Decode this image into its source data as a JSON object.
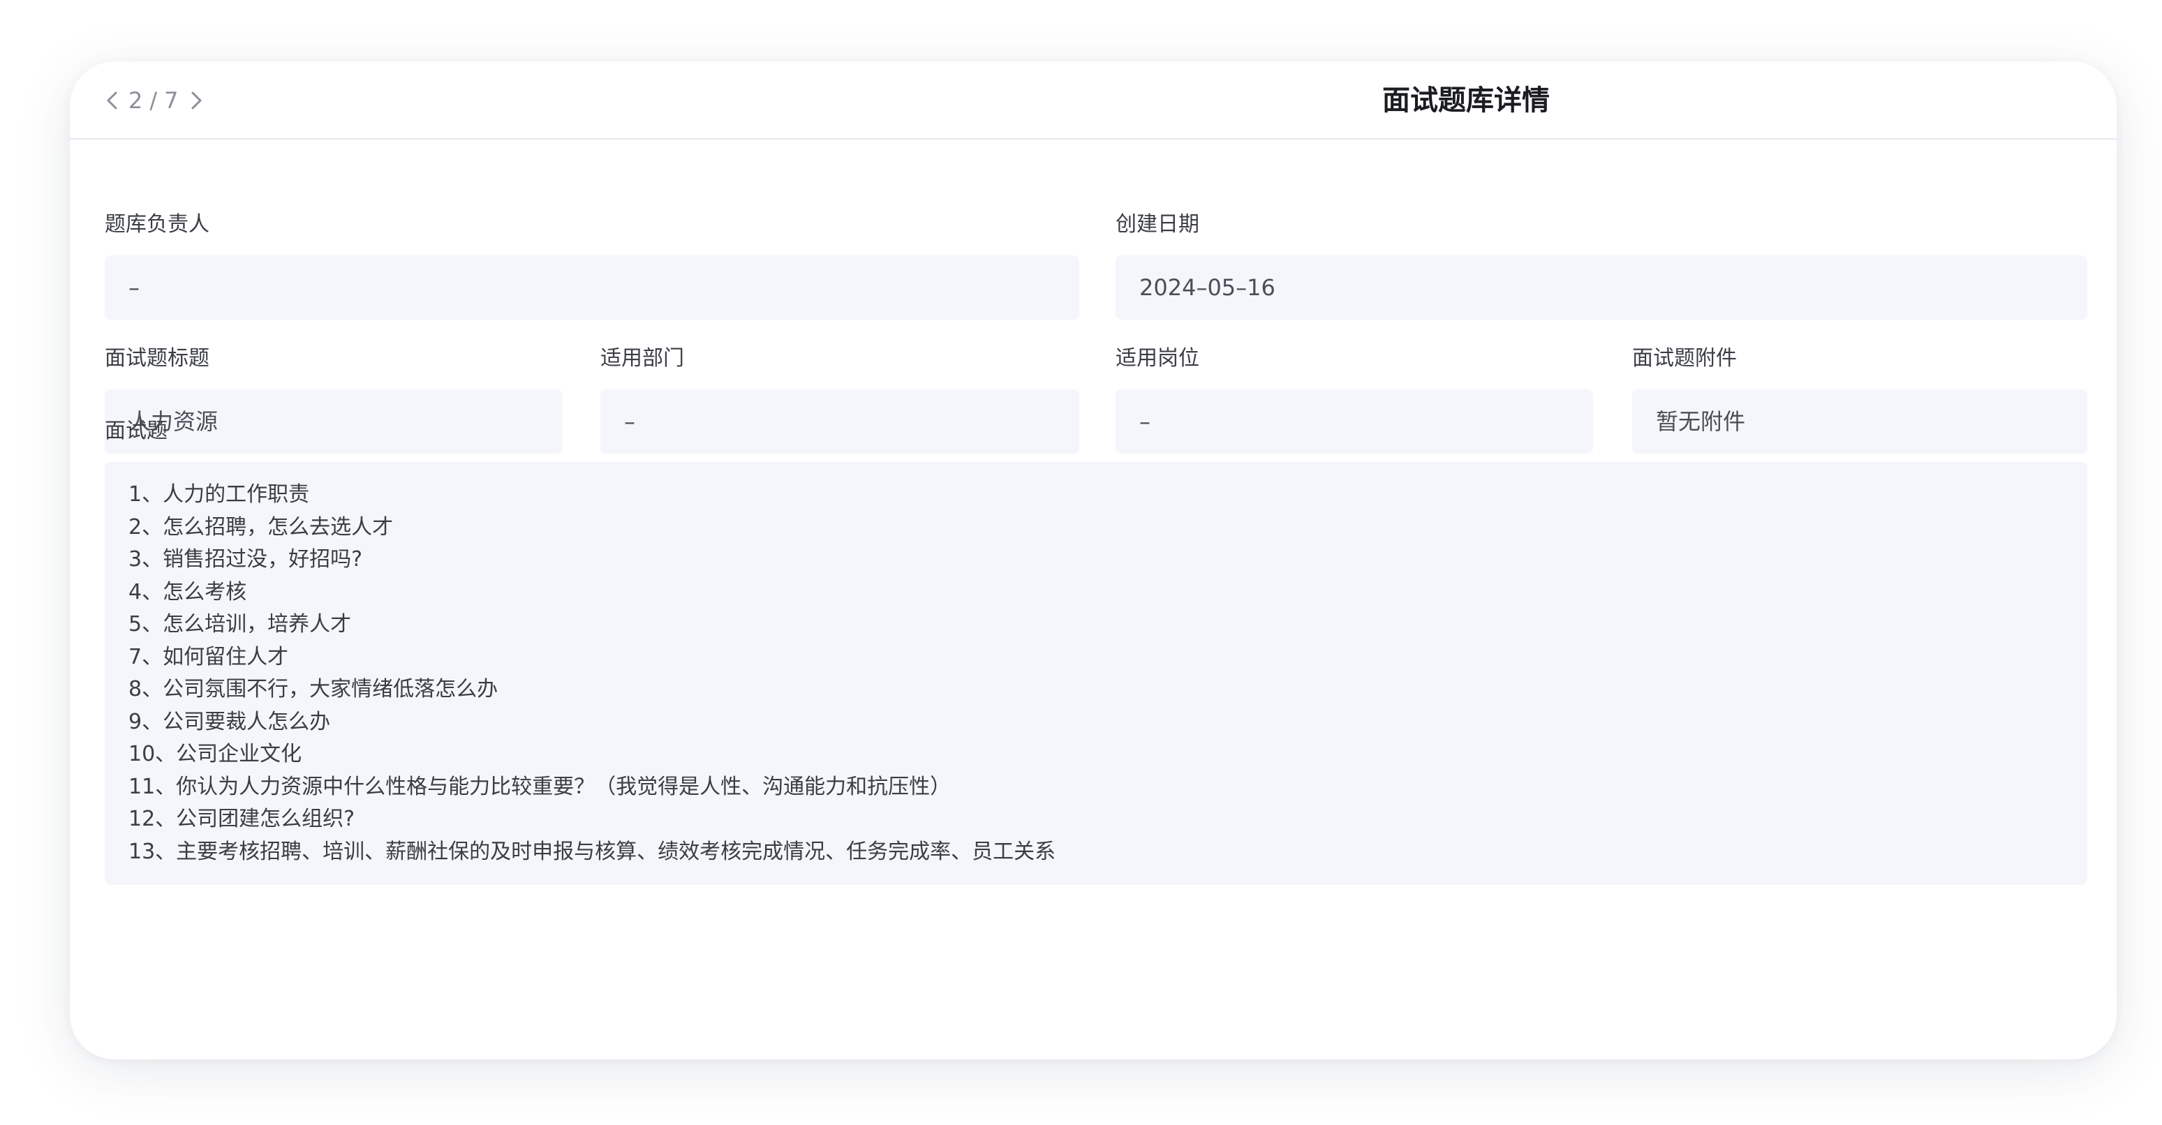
{
  "pager": {
    "current": "2",
    "separator": "/",
    "total": "7",
    "prev_icon": "chevron-left-icon",
    "next_icon": "chevron-right-icon"
  },
  "header": {
    "title": "面试题库详情"
  },
  "fields": {
    "owner": {
      "label": "题库负责人",
      "value": "–"
    },
    "created_date": {
      "label": "创建日期",
      "value": "2024–05–16"
    },
    "question_title": {
      "label": "面试题标题",
      "value": "人力资源"
    },
    "department": {
      "label": "适用部门",
      "value": "–"
    },
    "position": {
      "label": "适用岗位",
      "value": "–"
    },
    "attachment": {
      "label": "面试题附件",
      "value": "暂无附件"
    }
  },
  "questions": {
    "label": "面试题",
    "lines": [
      "1、人力的工作职责",
      "2、怎么招聘，怎么去选人才",
      "3、销售招过没，好招吗?",
      "4、怎么考核",
      "5、怎么培训，培养人才",
      "7、如何留住人才",
      "8、公司氛围不行，大家情绪低落怎么办",
      "9、公司要裁人怎么办",
      "10、公司企业文化",
      "11、你认为人力资源中什么性格与能力比较重要？（我觉得是人性、沟通能力和抗压性）",
      "12、公司团建怎么组织?",
      "13、主要考核招聘、培训、薪酬社保的及时申报与核算、绩效考核完成情况、任务完成率、员工关系"
    ]
  },
  "colors": {
    "field_bg": "#f4f6fb",
    "label_text": "#3a3d44",
    "muted_text": "#8a8f99",
    "title_text": "#1a1c20"
  }
}
